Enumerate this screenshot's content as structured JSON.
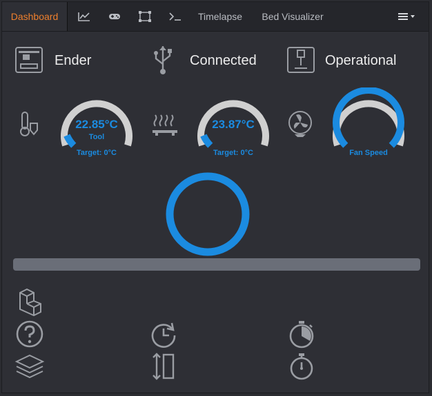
{
  "nav": {
    "tabs": [
      {
        "label": "Dashboard",
        "icon": null
      },
      {
        "label": "",
        "icon": "chart-line-icon"
      },
      {
        "label": "",
        "icon": "gamepad-icon"
      },
      {
        "label": "",
        "icon": "object-group-icon"
      },
      {
        "label": "",
        "icon": "terminal-icon"
      },
      {
        "label": "Timelapse",
        "icon": null
      },
      {
        "label": "Bed Visualizer",
        "icon": null
      }
    ],
    "menu_icon": "list-menu-icon",
    "active_color": "#ee7f2d"
  },
  "status": {
    "printer_name": "Ender",
    "connection": "Connected",
    "state": "Operational"
  },
  "gauges": {
    "tool": {
      "value": "22.85°C",
      "label": "Tool",
      "target": "Target: 0°C",
      "fill": 0.08
    },
    "bed": {
      "value": "23.87°C",
      "label": "",
      "target": "Target: 0°C",
      "fill": 0.08
    },
    "fan": {
      "label": "Fan Speed",
      "fill": 1.0
    }
  },
  "progress": {
    "fraction": 0.0
  },
  "colors": {
    "accent": "#1b8be0",
    "gauge_track": "#d0d0d0",
    "icon": "#9a9da3"
  },
  "icons": [
    "cube-icon",
    "help-icon",
    "layers-icon",
    "history-icon",
    "height-icon",
    "stopwatch-icon",
    "timer-icon"
  ]
}
